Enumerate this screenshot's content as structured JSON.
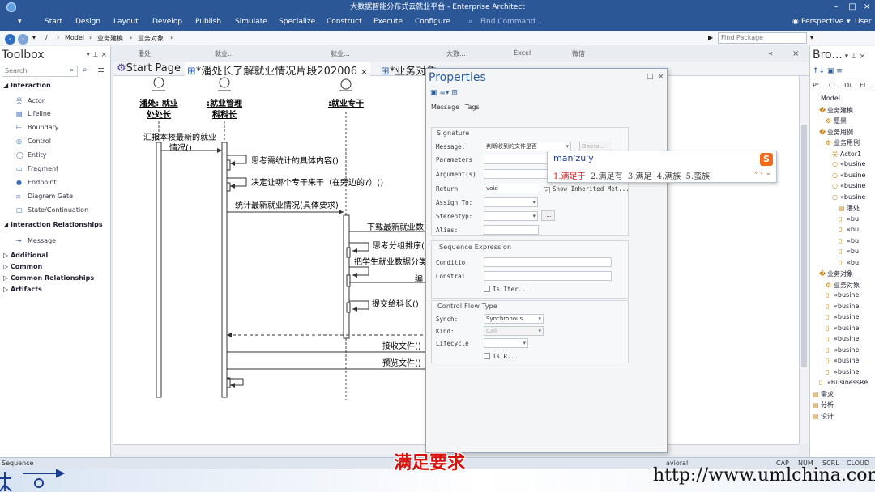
{
  "window": {
    "title": "大数据智能分布式云就业平台 - Enterprise Architect"
  },
  "ribbon": {
    "tabs": [
      "Start",
      "Design",
      "Layout",
      "Develop",
      "Publish",
      "Simulate",
      "Specialize",
      "Construct",
      "Execute",
      "Configure"
    ],
    "find_command": "Find Command...",
    "perspective": "Perspective",
    "user": "User"
  },
  "address": {
    "path": [
      "/",
      "Model",
      "业务建模",
      "业务对象"
    ],
    "find_package_placeholder": "Find Package"
  },
  "toolbox": {
    "title": "Toolbox",
    "search_placeholder": "Search",
    "interaction_header": "Interaction",
    "interaction_items": [
      "Actor",
      "Lifeline",
      "Boundary",
      "Control",
      "Entity",
      "Fragment",
      "Endpoint",
      "Diagram Gate",
      "State/Continuation"
    ],
    "relationships_header": "Interaction Relationships",
    "relationship_items": [
      "Message"
    ],
    "other_sections": [
      "Additional",
      "Common",
      "Common Relationships",
      "Artifacts"
    ]
  },
  "subtabs": [
    "潘处",
    "就业...",
    "就业...",
    "大数...",
    "Excel",
    "微信"
  ],
  "tabs": [
    "Start Page",
    "*潘处长了解就业情况片段202006",
    "*业务对象"
  ],
  "diagram": {
    "lifelines": [
      {
        "name_line1": "潘处: 就业",
        "name_line2": "处处长"
      },
      {
        "name_line1": ":就业管理",
        "name_line2": "科科长"
      },
      {
        "name_line1": ":就业专干",
        "name_line2": ""
      }
    ],
    "messages": [
      "汇报本校最新的就业",
      "情况()",
      "思考需统计的具体内容()",
      "决定让哪个专干来干（在旁边的?）()",
      "统计最新就业情况(具体要求)",
      "下载最新就业数",
      "思考分组排序()",
      "把学生就业数据分类",
      "编",
      "提交给科长()",
      "接收文件()",
      "预览文件()"
    ]
  },
  "properties": {
    "title": "Properties",
    "tabs": [
      "Message",
      "Tags"
    ],
    "signature_group": "Signature",
    "labels": {
      "message": "Message:",
      "parameters": "Parameters",
      "arguments": "Argument(s)",
      "return": "Return",
      "assign_to": "Assign To:",
      "stereotype": "Stereotyp:",
      "alias": "Alias:",
      "condition": "Conditio",
      "constraint": "Constrai",
      "synch": "Synch:",
      "kind": "Kind:",
      "lifecycle": "Lifecycle"
    },
    "values": {
      "message": "判断收到的文件是否",
      "operation_placeholder": "Opera...",
      "return": "void",
      "synch": "Synchronous",
      "kind": "Call",
      "more_btn": "..."
    },
    "show_inherited": "Show Inherited Met...",
    "sequence_group": "Sequence Expression",
    "is_iteration": "Is Iter...",
    "control_flow_group": "Control Flow Type",
    "is_return": "Is R..."
  },
  "ime": {
    "composition": "man'zu'y",
    "candidates": [
      "1.满足于",
      "2.满足有",
      "3.满足",
      "4.满族",
      "5.蛮族"
    ],
    "logo": "S"
  },
  "browser": {
    "title": "Bro...",
    "tabs": [
      "Pr...",
      "Cl...",
      "Di...",
      "El..."
    ],
    "nodes": [
      "Model",
      "业务建模",
      "愿景",
      "业务用例",
      "业务用例",
      "Actor1",
      "«busine",
      "«busine",
      "«busine",
      "«busine",
      "潘处",
      "«bu",
      "«bu",
      "«bu",
      "«bu",
      "«bu",
      "业务对象",
      "业务对象",
      "«busine",
      "«busine",
      "«busine",
      "«busine",
      "«busine",
      "«busine",
      "«busine",
      "«busine",
      "«BusinessRe",
      "需求",
      "分析",
      "设计"
    ]
  },
  "statusbar": {
    "left": "Sequence",
    "right": "avioral",
    "indicators": [
      "CAP",
      "NUM",
      "SCRL",
      "CLOUD"
    ]
  },
  "overlay": {
    "subtitle": "满足要求",
    "url": "http://www.umlchina.com"
  }
}
